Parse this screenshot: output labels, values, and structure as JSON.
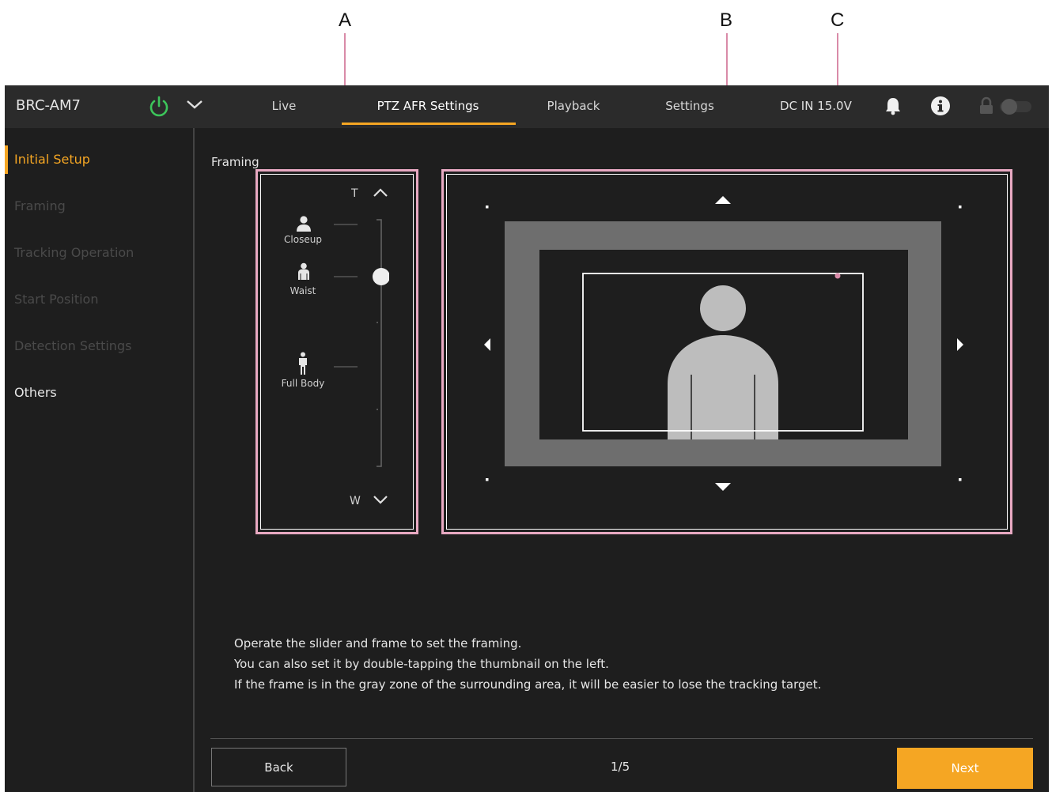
{
  "callouts": {
    "a": "A",
    "b": "B",
    "c": "C"
  },
  "header": {
    "model": "BRC-AM7",
    "tabs": [
      "Live",
      "PTZ AFR Settings",
      "Playback",
      "Settings"
    ],
    "active_tab": "PTZ AFR Settings",
    "status": "DC IN 15.0V"
  },
  "sidebar": {
    "items": [
      "Initial Setup",
      "Framing",
      "Tracking Operation",
      "Start Position",
      "Detection Settings",
      "Others"
    ],
    "active": "Initial Setup"
  },
  "main": {
    "section_title": "Framing",
    "zoom": {
      "tele_label": "T",
      "wide_label": "W",
      "presets": [
        "Closeup",
        "Waist",
        "Full Body"
      ],
      "selected_preset": "Waist"
    },
    "instructions": [
      "Operate the slider and frame to set the framing.",
      "You can also set it by double-tapping the thumbnail on the left.",
      "If the frame is in the gray zone of the surrounding area, it will be easier to lose the tracking target."
    ]
  },
  "footer": {
    "back_label": "Back",
    "page": "1/5",
    "next_label": "Next"
  },
  "colors": {
    "accent": "#f5a623",
    "power": "#3cc45a",
    "callout_box": "#e8a9c2",
    "zone_gray": "#6e6e6e",
    "subject": "#bdbdbd"
  }
}
